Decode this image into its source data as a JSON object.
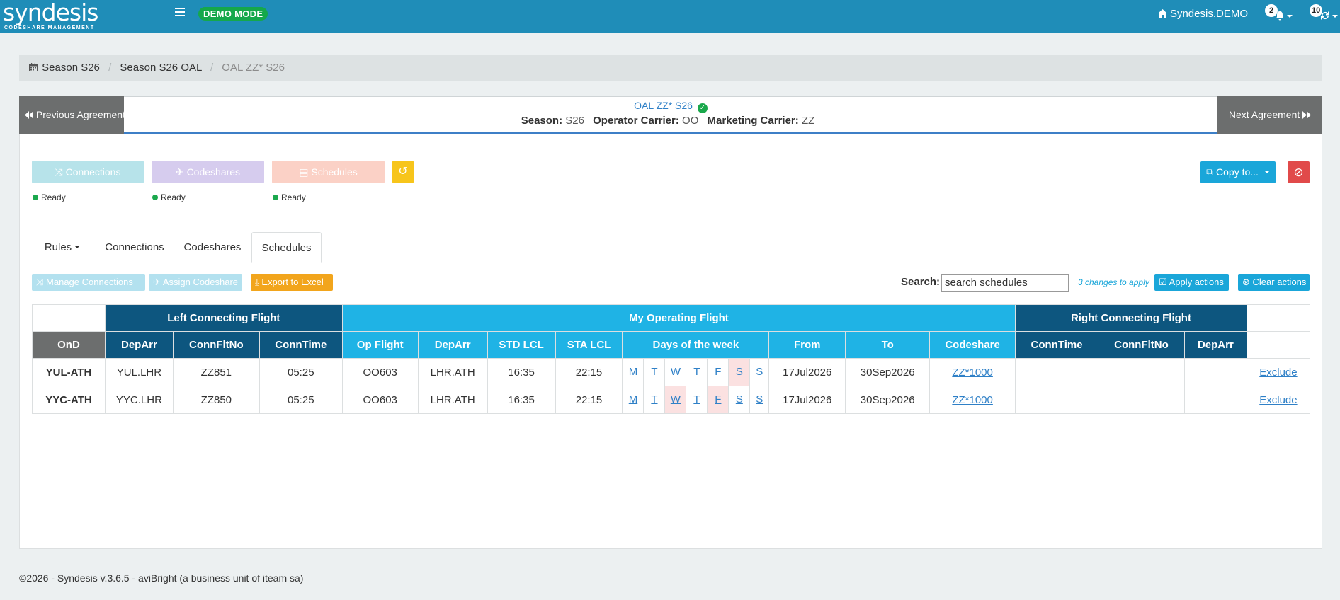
{
  "brand": {
    "name": "syndesis",
    "subtitle": "CODESHARE MANAGEMENT",
    "mode_badge": "DEMO MODE"
  },
  "topbar": {
    "home_label": "Syndesis.DEMO",
    "notifications_count": "2",
    "sync_count": "10"
  },
  "breadcrumb": {
    "items": [
      "Season S26",
      "Season S26 OAL",
      "OAL ZZ* S26"
    ]
  },
  "agreement": {
    "prev_label": "Previous Agreement",
    "next_label": "Next Agreement",
    "title": "OAL ZZ* S26",
    "season_label": "Season:",
    "season_value": "S26",
    "operator_label": "Operator Carrier:",
    "operator_value": "OO",
    "marketing_label": "Marketing Carrier:",
    "marketing_value": "ZZ"
  },
  "status": {
    "connections_label": "Connections",
    "codeshares_label": "Codeshares",
    "schedules_label": "Schedules",
    "ready_label": "Ready"
  },
  "toolbar": {
    "copy_label": "Copy to..."
  },
  "tabs": [
    "Rules",
    "Connections",
    "Codeshares",
    "Schedules"
  ],
  "actions": {
    "manage_connections": "Manage Connections",
    "assign_codeshare": "Assign Codeshare",
    "export_excel": "Export to Excel",
    "search_label": "Search:",
    "search_value": "search schedules",
    "changes_note": "3 changes to apply",
    "apply_actions": "Apply actions",
    "clear_actions": "Clear actions"
  },
  "table": {
    "groups": {
      "left": "Left Connecting Flight",
      "my": "My Operating Flight",
      "right": "Right Connecting Flight"
    },
    "columns": [
      "OnD",
      "DepArr",
      "ConnFltNo",
      "ConnTime",
      "Op Flight",
      "DepArr",
      "STD LCL",
      "STA LCL",
      "Days of the week",
      "From",
      "To",
      "Codeshare",
      "ConnTime",
      "ConnFltNo",
      "DepArr"
    ],
    "day_letters": [
      "M",
      "T",
      "W",
      "T",
      "F",
      "S",
      "S"
    ],
    "rows": [
      {
        "ond": "YUL-ATH",
        "deparr": "YUL.LHR",
        "connflt": "ZZ851",
        "conntime": "05:25",
        "opflight": "OO603",
        "op_deparr": "LHR.ATH",
        "std": "16:35",
        "sta": "22:15",
        "from": "17Jul2026",
        "to": "30Sep2026",
        "codeshare": "ZZ*1000",
        "action": "Exclude"
      },
      {
        "ond": "YYC-ATH",
        "deparr": "YYC.LHR",
        "connflt": "ZZ850",
        "conntime": "05:25",
        "opflight": "OO603",
        "op_deparr": "LHR.ATH",
        "std": "16:35",
        "sta": "22:15",
        "from": "17Jul2026",
        "to": "30Sep2026",
        "codeshare": "ZZ*1000",
        "action": "Exclude"
      }
    ]
  },
  "footer": {
    "text": "©2026 - Syndesis v.3.6.5 - aviBright (a business unit of iteam sa)"
  }
}
